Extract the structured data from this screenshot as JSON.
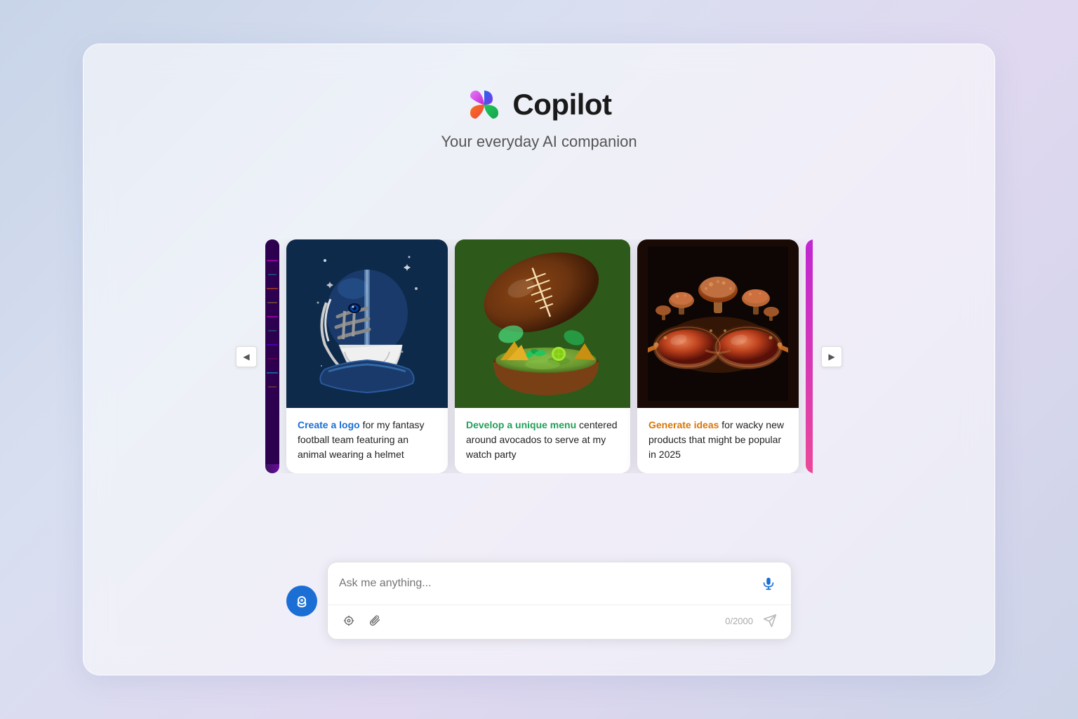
{
  "app": {
    "title": "Copilot",
    "subtitle": "Your everyday AI companion"
  },
  "carousel": {
    "prev_label": "◀",
    "next_label": "▶",
    "cards": [
      {
        "id": "card1",
        "highlight": "Create a logo",
        "highlight_class": "highlight-blue",
        "text": " for my fantasy football team featuring an animal wearing a helmet"
      },
      {
        "id": "card2",
        "highlight": "Develop a unique menu",
        "highlight_class": "highlight-green",
        "text": " centered around avocados to serve at my watch party"
      },
      {
        "id": "card3",
        "highlight": "Generate ideas",
        "highlight_class": "highlight-orange",
        "text": " for wacky new products that might be popular in 2025"
      }
    ]
  },
  "input": {
    "placeholder": "Ask me anything...",
    "char_count": "0/2000"
  }
}
